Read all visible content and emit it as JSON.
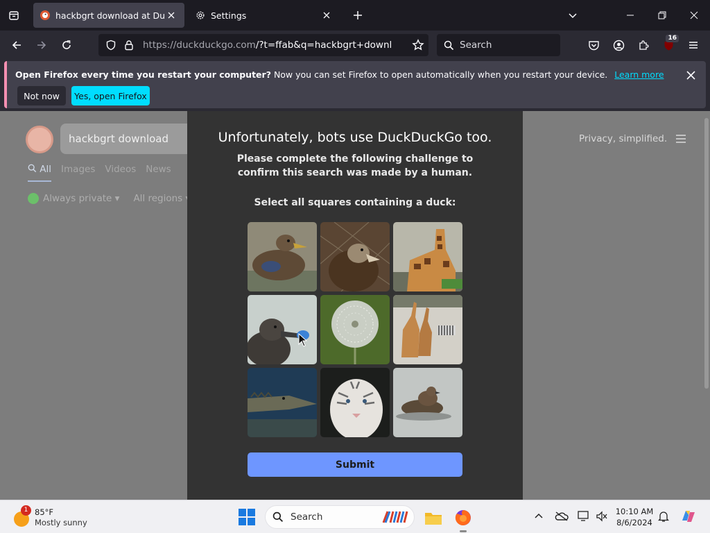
{
  "browser": {
    "tabs": [
      {
        "title": "hackbgrt download at DuckDuckGo",
        "active": true
      },
      {
        "title": "Settings",
        "active": false
      }
    ],
    "url": {
      "host": "https://duckduckgo.com",
      "path": "/?t=ffab&q=hackbgrt+download"
    },
    "search_placeholder": "Search",
    "extensions_badge": "16"
  },
  "notification": {
    "bold_text": "Open Firefox every time you restart your computer?",
    "text": "Now you can set Firefox to open automatically when you restart your device.",
    "link": "Learn more",
    "secondary_button": "Not now",
    "primary_button": "Yes, open Firefox"
  },
  "ddg": {
    "search_value": "hackbgrt download",
    "tabs": [
      "All",
      "Images",
      "Videos",
      "News"
    ],
    "filters": [
      "Always private",
      "All regions"
    ],
    "tagline": "Privacy, simplified."
  },
  "challenge": {
    "title": "Unfortunately, bots use DuckDuckGo too.",
    "subtitle": "Please complete the following challenge to confirm this search was made by a human.",
    "instruction": "Select all squares containing a duck:",
    "tiles": [
      "duck",
      "vulture",
      "giraffe",
      "duck-with-toy",
      "dandelion",
      "giraffes-and-zebra",
      "crocodile",
      "white-tiger",
      "ducklings"
    ],
    "submit_label": "Submit"
  },
  "taskbar": {
    "weather_alert": "1",
    "temperature": "85°F",
    "condition": "Mostly sunny",
    "search_label": "Search",
    "time": "10:10 AM",
    "date": "8/6/2024"
  },
  "colors": {
    "accent_cyan": "#00ddff",
    "submit_blue": "#6e96ff",
    "notif_stripe": "#f48fb1"
  }
}
